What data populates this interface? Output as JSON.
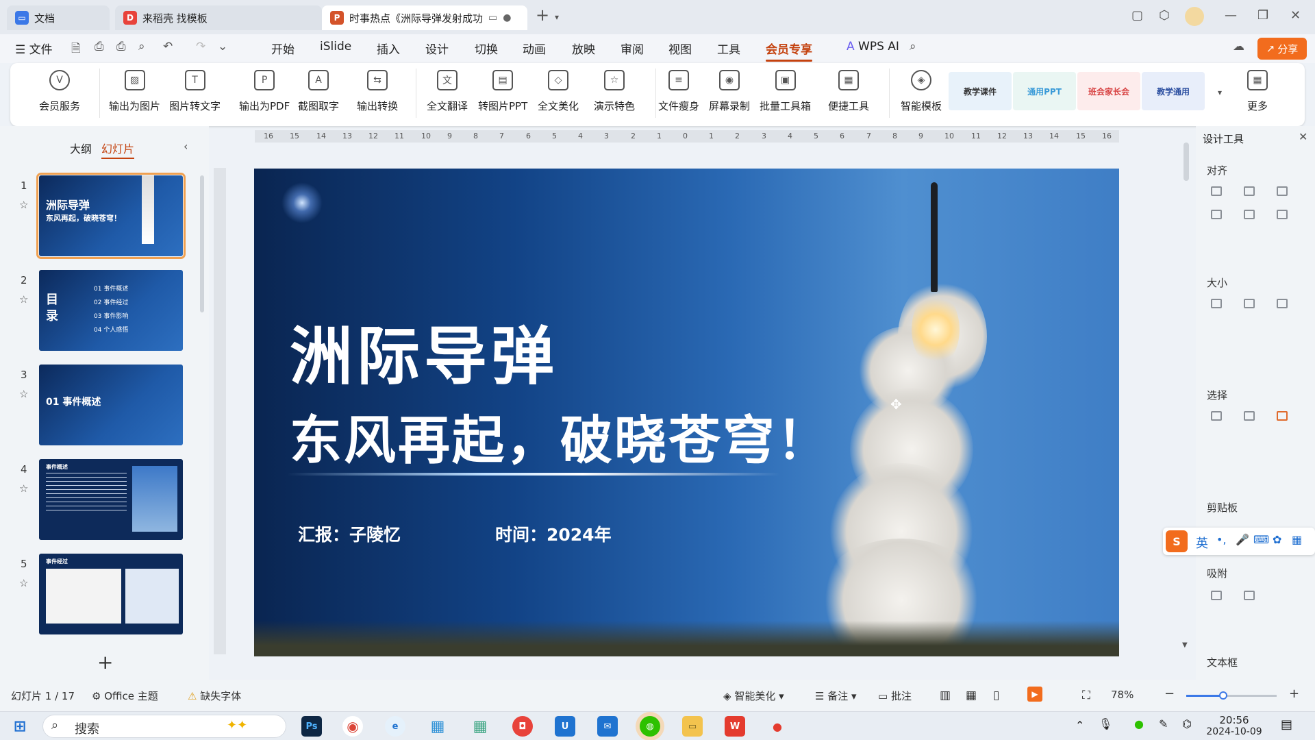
{
  "tabs": [
    {
      "label": "文档",
      "icon": "docs-icon"
    },
    {
      "label": "来稻壳 找模板",
      "icon": "docer-icon"
    },
    {
      "label": "时事热点《洲际导弹发射成功",
      "icon": "ppt-icon"
    }
  ],
  "menu": {
    "file": "文件",
    "items": [
      "开始",
      "iSlide",
      "插入",
      "设计",
      "切换",
      "动画",
      "放映",
      "审阅",
      "视图",
      "工具",
      "会员专享"
    ],
    "active": "会员专享",
    "wps_ai": "WPS AI",
    "share": "分享"
  },
  "ribbon": {
    "buttons": [
      "会员服务",
      "输出为图片",
      "图片转文字",
      "输出为PDF",
      "截图取字",
      "输出转换",
      "全文翻译",
      "转图片PPT",
      "全文美化",
      "演示特色",
      "文件瘦身",
      "屏幕录制",
      "批量工具箱",
      "便捷工具",
      "智能模板"
    ],
    "templates": [
      "教学课件",
      "通用PPT",
      "班会家长会",
      "教学通用"
    ],
    "more": "更多"
  },
  "left_panel": {
    "tab_outline": "大纲",
    "tab_slides": "幻灯片",
    "thumbs": [
      {
        "num": "1",
        "title": "洲际导弹",
        "subtitle": "东风再起，破晓苍穹！"
      },
      {
        "num": "2",
        "title": "目录",
        "items": [
          "01 事件概述",
          "02 事件经过",
          "03 事件影响",
          "04 个人感悟"
        ]
      },
      {
        "num": "3",
        "title": "01 事件概述"
      },
      {
        "num": "4",
        "title": "事件概述"
      },
      {
        "num": "5",
        "title": "事件经过"
      }
    ]
  },
  "slide": {
    "title": "洲际导弹",
    "subtitle": "东风再起，破晓苍穹！",
    "reporter": "汇报：子陵忆",
    "time": "时间：2024年"
  },
  "ruler_labels": [
    "16",
    "15",
    "14",
    "13",
    "12",
    "11",
    "10",
    "9",
    "8",
    "7",
    "6",
    "5",
    "4",
    "3",
    "2",
    "1",
    "0",
    "1",
    "2",
    "3",
    "4",
    "5",
    "6",
    "7",
    "8",
    "9",
    "10",
    "11",
    "12",
    "13",
    "14",
    "15",
    "16"
  ],
  "right_panel": {
    "title": "设计工具",
    "sections": [
      "对齐",
      "大小",
      "选择",
      "剪贴板",
      "吸附",
      "文本框"
    ]
  },
  "statusbar": {
    "slide_info": "幻灯片 1 / 17",
    "theme": "Office 主题",
    "missing_font": "缺失字体",
    "smart_beautify": "智能美化",
    "notes": "备注",
    "comments": "批注",
    "zoom": "78%"
  },
  "ime": {
    "lang": "英"
  },
  "taskbar": {
    "search": "搜索",
    "time": "20:56",
    "date": "2024-10-09"
  },
  "colors": {
    "accent": "#c4420f",
    "share": "#f26c1d",
    "slide_bg": "#124386"
  }
}
